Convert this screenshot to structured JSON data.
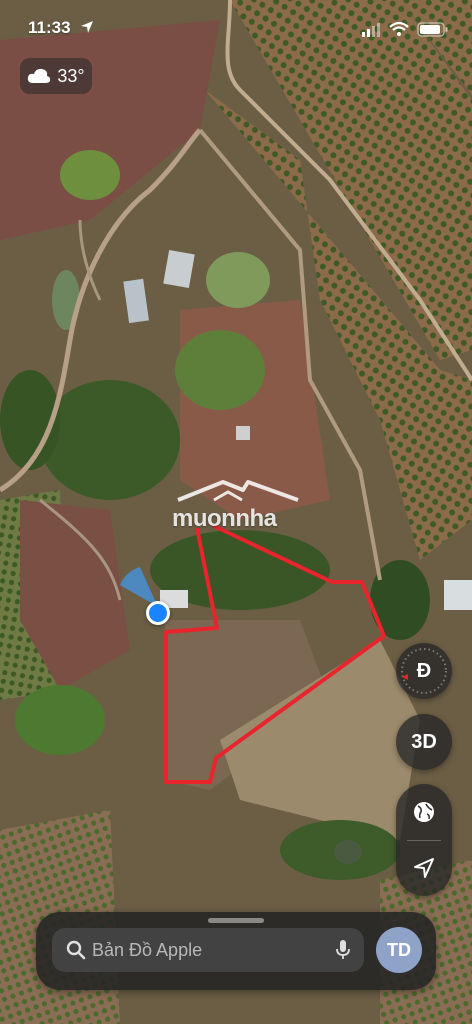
{
  "status_bar": {
    "time": "11:33"
  },
  "weather": {
    "temperature": "33°",
    "icon": "cloud-icon"
  },
  "watermark": {
    "brand": "muonnha"
  },
  "controls": {
    "compass_label": "Đ",
    "three_d_label": "3D",
    "globe_icon": "globe-icon",
    "location_icon": "location-arrow-icon"
  },
  "search": {
    "placeholder": "Bản Đồ Apple"
  },
  "profile": {
    "initials": "TD"
  },
  "colors": {
    "boundary": "#e8242c",
    "user_dot": "#1a84ff"
  }
}
